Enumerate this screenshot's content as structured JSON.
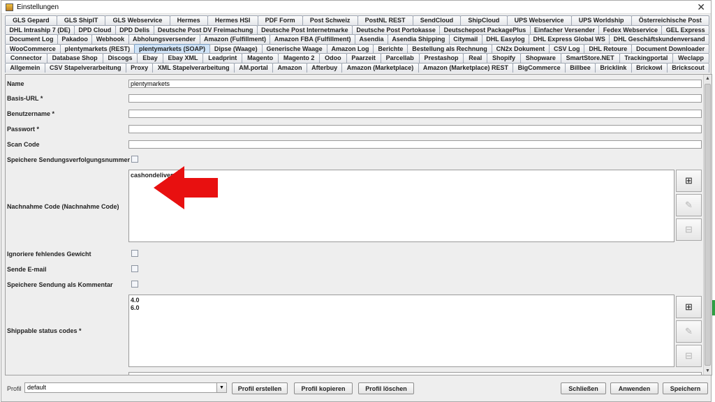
{
  "window": {
    "title": "Einstellungen",
    "close_symbol": "✕"
  },
  "tabs": {
    "rows": [
      [
        "GLS Gepard",
        "GLS ShipIT",
        "GLS Webservice",
        "Hermes",
        "Hermes HSI",
        "PDF Form",
        "Post Schweiz",
        "PostNL REST",
        "SendCloud",
        "ShipCloud",
        "UPS Webservice",
        "UPS Worldship",
        "Österreichische Post"
      ],
      [
        "DHL Intraship 7 (DE)",
        "DPD Cloud",
        "DPD Delis",
        "Deutsche Post DV Freimachung",
        "Deutsche Post Internetmarke",
        "Deutsche Post Portokasse",
        "Deutschepost PackagePlus",
        "Einfacher Versender",
        "Fedex Webservice",
        "GEL Express"
      ],
      [
        "Document Log",
        "Pakadoo",
        "Webhook",
        "Abholungsversender",
        "Amazon (Fulfillment)",
        "Amazon FBA (Fulfillment)",
        "Asendia",
        "Asendia Shipping",
        "Citymail",
        "DHL Easylog",
        "DHL Express Global WS",
        "DHL Geschäftskundenversand"
      ],
      [
        "WooCommerce",
        "plentymarkets (REST)",
        "plentymarkets (SOAP)",
        "Dipse (Waage)",
        "Generische Waage",
        "Amazon Log",
        "Berichte",
        "Bestellung als Rechnung",
        "CN2x Dokument",
        "CSV Log",
        "DHL Retoure",
        "Document Downloader"
      ],
      [
        "Connector",
        "Database Shop",
        "Discogs",
        "Ebay",
        "Ebay XML",
        "Leadprint",
        "Magento",
        "Magento 2",
        "Odoo",
        "Paarzeit",
        "Parcellab",
        "Prestashop",
        "Real",
        "Shopify",
        "Shopware",
        "SmartStore.NET",
        "Trackingportal",
        "Weclapp"
      ],
      [
        "Allgemein",
        "CSV Stapelverarbeitung",
        "Proxy",
        "XML Stapelverarbeitung",
        "AM.portal",
        "Amazon",
        "Afterbuy",
        "Amazon (Marketplace)",
        "Amazon (Marketplace) REST",
        "BigCommerce",
        "Billbee",
        "Bricklink",
        "Brickowl",
        "Brickscout"
      ]
    ],
    "selected": "plentymarkets (SOAP)"
  },
  "form": {
    "name_label": "Name",
    "name_value": "plentymarkets",
    "basis_url_label": "Basis-URL *",
    "basis_url_value": "",
    "benutzername_label": "Benutzername *",
    "benutzername_value": "",
    "passwort_label": "Passwort *",
    "passwort_value": "",
    "scan_code_label": "Scan Code",
    "scan_code_value": "",
    "speichere_tracking_label": "Speichere Sendungsverfolgungsnummer",
    "nachnahme_label": "Nachnahme Code (Nachnahme Code)",
    "nachnahme_items": [
      "cashondelivery"
    ],
    "ignoriere_gewicht_label": "Ignoriere fehlendes Gewicht",
    "sende_email_label": "Sende E-mail",
    "speichere_kommentar_label": "Speichere Sendung als Kommentar",
    "shippable_label": "Shippable status codes *",
    "shippable_items": [
      "4.0",
      "6.0"
    ]
  },
  "list_buttons": {
    "add_symbol": "⊞",
    "edit_symbol": "✎",
    "remove_symbol": "⊟"
  },
  "bottom_bar": {
    "profile_label": "Profil",
    "profile_value": "default",
    "dropdown_symbol": "▼",
    "create_label": "Profil erstellen",
    "copy_label": "Profil kopieren",
    "delete_label": "Profil löschen",
    "close_label": "Schließen",
    "apply_label": "Anwenden",
    "save_label": "Speichern"
  },
  "scrollbar": {
    "up_symbol": "▲",
    "down_symbol": "▼"
  },
  "colors": {
    "accent_arrow": "#e81010",
    "selected_tab": "#cfe3f7",
    "edge_green": "#2ea043"
  }
}
